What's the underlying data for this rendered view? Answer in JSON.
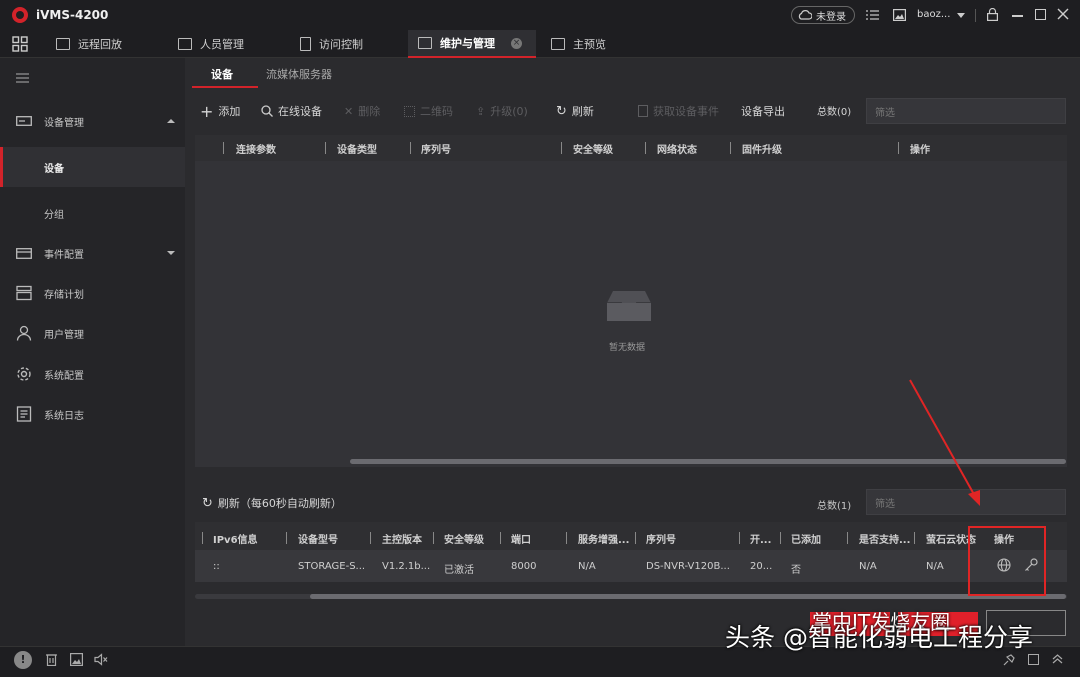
{
  "app": {
    "title": "iVMS-4200",
    "login_status": "未登录",
    "user": "baoz..."
  },
  "tabs": [
    {
      "label": "远程回放"
    },
    {
      "label": "人员管理"
    },
    {
      "label": "访问控制"
    },
    {
      "label": "维护与管理"
    },
    {
      "label": "主预览"
    }
  ],
  "sidebar": {
    "device_mgmt": "设备管理",
    "device": "设备",
    "group": "分组",
    "event_config": "事件配置",
    "storage_plan": "存储计划",
    "user_mgmt": "用户管理",
    "system_config": "系统配置",
    "system_log": "系统日志"
  },
  "subtabs": {
    "device": "设备",
    "stream": "流媒体服务器"
  },
  "toolbar": {
    "add": "添加",
    "online": "在线设备",
    "delete": "删除",
    "qrcode": "二维码",
    "upgrade": "升级(0)",
    "refresh": "刷新",
    "get_events": "获取设备事件",
    "export": "设备导出",
    "total": "总数(0)",
    "filter": "筛选"
  },
  "table1": {
    "headers": [
      "连接参数",
      "设备类型",
      "序列号",
      "安全等级",
      "网络状态",
      "固件升级",
      "操作"
    ],
    "empty": "暂无数据"
  },
  "online": {
    "refresh": "刷新（每60秒自动刷新）",
    "total": "总数(1)",
    "filter": "筛选",
    "headers": [
      "IPv6信息",
      "设备型号",
      "主控版本",
      "安全等级",
      "端口",
      "服务增强...",
      "序列号",
      "开...",
      "已添加",
      "是否支持...",
      "萤石云状态",
      "操作"
    ],
    "row": [
      "::",
      "STORAGE-S...",
      "V1.2.1b...",
      "已激活",
      "8000",
      "N/A",
      "DS-NVR-V120B...",
      "20...",
      "否",
      "N/A",
      "N/A"
    ]
  },
  "watermark": {
    "line1": "掌中IT发烧友圈",
    "line2": "头条 @智能化弱电工程分享"
  },
  "colors": {
    "accent": "#d2232a",
    "background": "#2b2b2e",
    "highlight": "#e02525"
  }
}
